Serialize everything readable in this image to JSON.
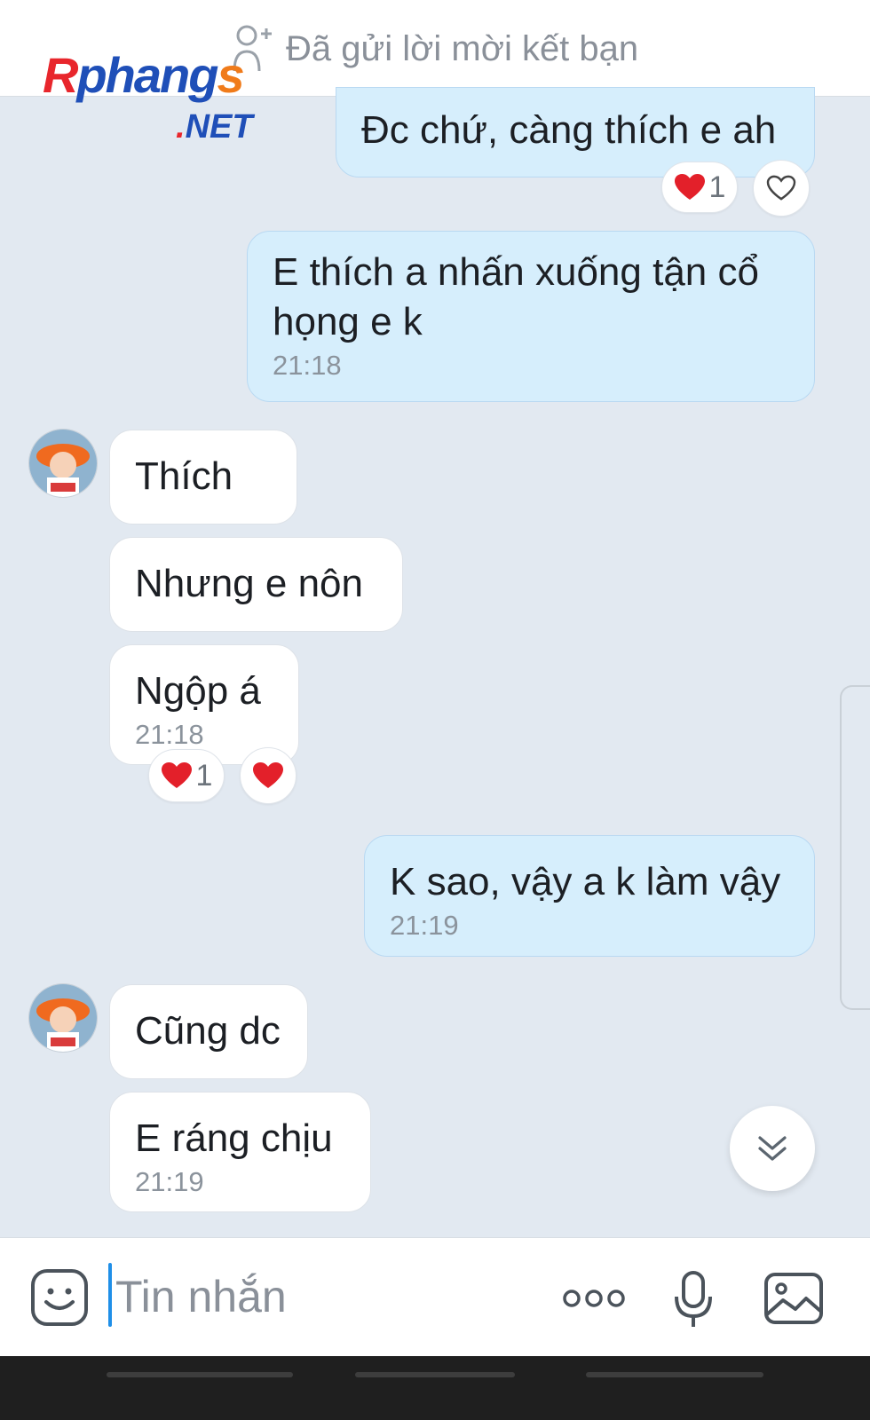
{
  "header": {
    "friend_request_label": "Đã gửi lời mời kết bạn"
  },
  "watermark": {
    "brand": "Rphangs",
    "suffix": ".NET"
  },
  "messages": [
    {
      "side": "sent",
      "text": "Đc chứ, càng thích e ah",
      "time": ""
    },
    {
      "side": "sent",
      "text": "E thích a nhấn xuống tận cổ họng e k",
      "time": "21:18"
    },
    {
      "side": "recv",
      "text": "Thích",
      "time": ""
    },
    {
      "side": "recv",
      "text": "Nhưng e nôn",
      "time": ""
    },
    {
      "side": "recv",
      "text": "Ngộp á",
      "time": "21:18"
    },
    {
      "side": "sent",
      "text": "K sao, vậy a k làm vậy",
      "time": "21:19"
    },
    {
      "side": "recv",
      "text": "Cũng dc",
      "time": ""
    },
    {
      "side": "recv",
      "text": "E ráng chịu",
      "time": "21:19"
    }
  ],
  "reactions": {
    "msg1_count": "1",
    "msg5_count": "1"
  },
  "composer": {
    "placeholder": "Tin nhắn"
  },
  "icons": {
    "add_friend": "add-friend-icon",
    "heart": "heart-icon",
    "emoji": "emoji-icon",
    "more": "more-icon",
    "mic": "microphone-icon",
    "image": "image-icon",
    "scroll_down": "double-chevron-down-icon"
  },
  "colors": {
    "sent_bubble": "#d6eefc",
    "recv_bubble": "#ffffff",
    "background": "#e2e9f1",
    "heart": "#e3202a",
    "cursor": "#1f8fe8"
  }
}
